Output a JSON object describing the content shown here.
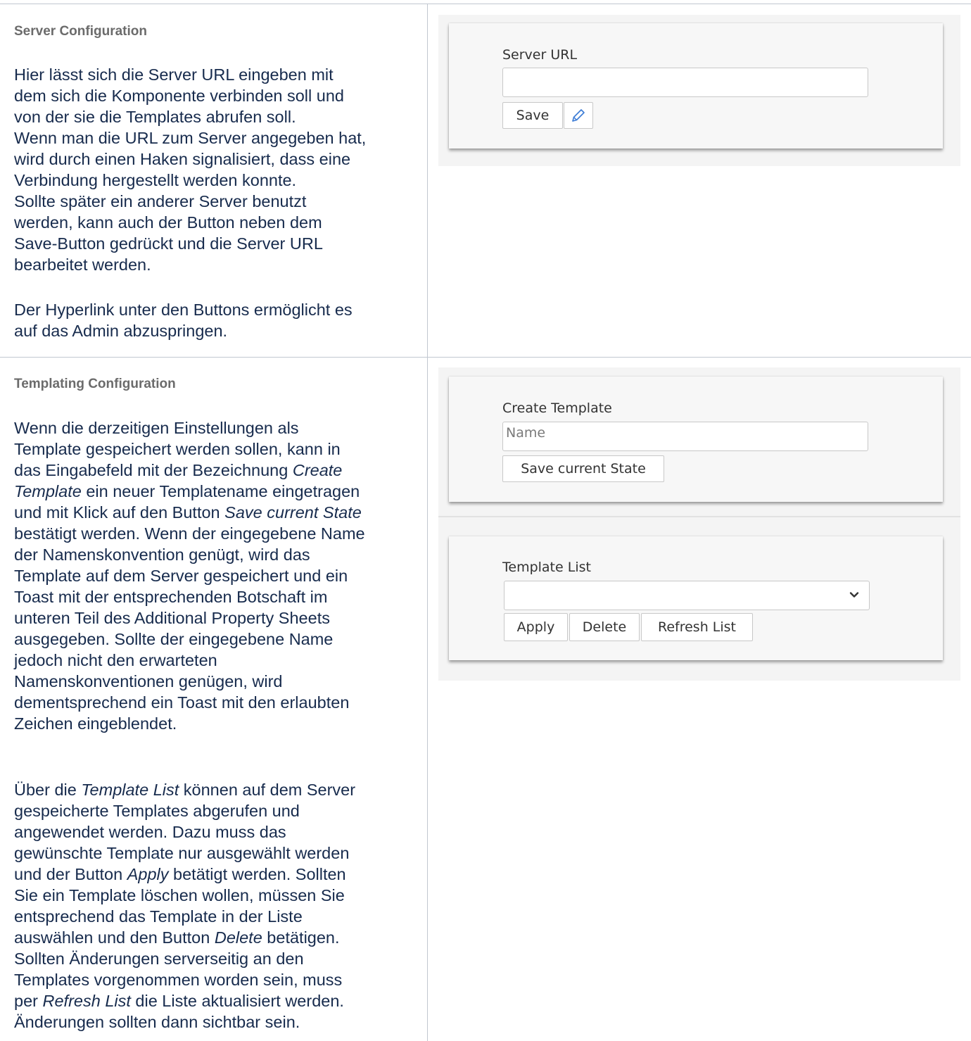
{
  "sections": [
    {
      "heading": "Server Configuration",
      "paragraphs": [
        {
          "lines": [
            "Hier lässt sich die Server URL eingeben mit",
            "dem sich die Komponente verbinden soll und",
            "von der sie die Templates abrufen soll.",
            "Wenn man die URL zum Server angegeben hat,",
            "wird durch einen Haken signalisiert, dass eine",
            "Verbindung hergestellt werden konnte.",
            "Sollte später ein anderer Server benutzt",
            "werden, kann auch der Button neben dem",
            "Save-Button gedrückt und die Server URL",
            "bearbeitet werden."
          ]
        },
        {
          "lines": [
            "Der Hyperlink unter den Buttons ermöglicht es",
            "auf das Admin abzuspringen."
          ]
        }
      ]
    },
    {
      "heading": "Templating Configuration",
      "para1": {
        "l1": "Wenn die derzeitigen Einstellungen als",
        "l2": "Template gespeichert werden sollen, kann in",
        "l3a": "das Eingabefeld mit der Bezeichnung ",
        "l3em": "Create",
        "l4em": "Template",
        "l4b": " ein neuer Templatename eingetragen",
        "l5a": "und mit Klick auf den Button ",
        "l5em": "Save current State",
        "l6": "bestätigt werden. Wenn der eingegebene Name",
        "l7": "der Namenskonvention genügt, wird das",
        "l8": "Template auf dem Server gespeichert und ein",
        "l9": "Toast mit der entsprechenden Botschaft im",
        "l10": "unteren Teil des Additional Property Sheets",
        "l11": "ausgegeben. Sollte der eingegebene Name",
        "l12": "jedoch nicht den erwarteten",
        "l13": "Namenskonventionen genügen, wird",
        "l14": "dementsprechend ein Toast mit den erlaubten",
        "l15": "Zeichen eingeblendet."
      },
      "para2": {
        "l1a": "Über die ",
        "l1em": "Template List",
        "l1b": " können auf dem Server",
        "l2": "gespeicherte Templates abgerufen und",
        "l3": "angewendet werden. Dazu muss das",
        "l4": "gewünschte Template nur ausgewählt werden",
        "l5a": "und der Button ",
        "l5em": "Apply",
        "l5b": " betätigt werden. Sollten",
        "l6": "Sie ein Template löschen wollen, müssen Sie",
        "l7": "entsprechend das Template in der Liste",
        "l8a": "auswählen und den Button ",
        "l8em": "Delete",
        "l8b": " betätigen.",
        "l9": "Sollten Änderungen serverseitig an den",
        "l10": "Templates vorgenommen worden sein, muss",
        "l11a": "per ",
        "l11em": "Refresh List",
        "l11b": " die Liste aktualisiert werden.",
        "l12": "Änderungen sollten dann sichtbar sein."
      }
    }
  ],
  "ui": {
    "server_card": {
      "label": "Server URL",
      "input_value": "",
      "save_label": "Save",
      "edit_icon": "pencil-icon"
    },
    "create_template_card": {
      "label": "Create Template",
      "placeholder": "Name",
      "button_label": "Save current State"
    },
    "template_list_card": {
      "label": "Template List",
      "selected_value": "",
      "apply_label": "Apply",
      "delete_label": "Delete",
      "refresh_label": "Refresh List",
      "dropdown_icon": "chevron-down-icon"
    }
  },
  "colors": {
    "body_text": "#172b4d",
    "heading_text": "#6b6b6b",
    "border": "#c1c7d0",
    "pencil": "#3a7bd5"
  }
}
